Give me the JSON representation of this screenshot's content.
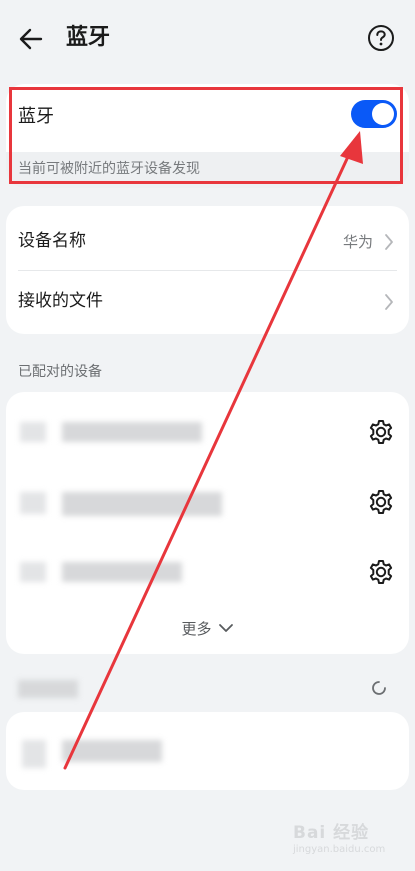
{
  "header": {
    "title": "蓝牙"
  },
  "bluetooth": {
    "label": "蓝牙",
    "enabled": true,
    "description": "当前可被附近的蓝牙设备发现"
  },
  "device_settings": [
    {
      "label": "设备名称",
      "value": "华为"
    },
    {
      "label": "接收的文件",
      "value": ""
    }
  ],
  "paired_section": {
    "title": "已配对的设备",
    "more_label": "更多"
  },
  "watermark": {
    "brand": "Bai 经验",
    "url": "jingyan.baidu.com"
  },
  "colors": {
    "accent": "#0a59f7",
    "annotation": "#e8363c",
    "background": "#f1f3f5"
  }
}
